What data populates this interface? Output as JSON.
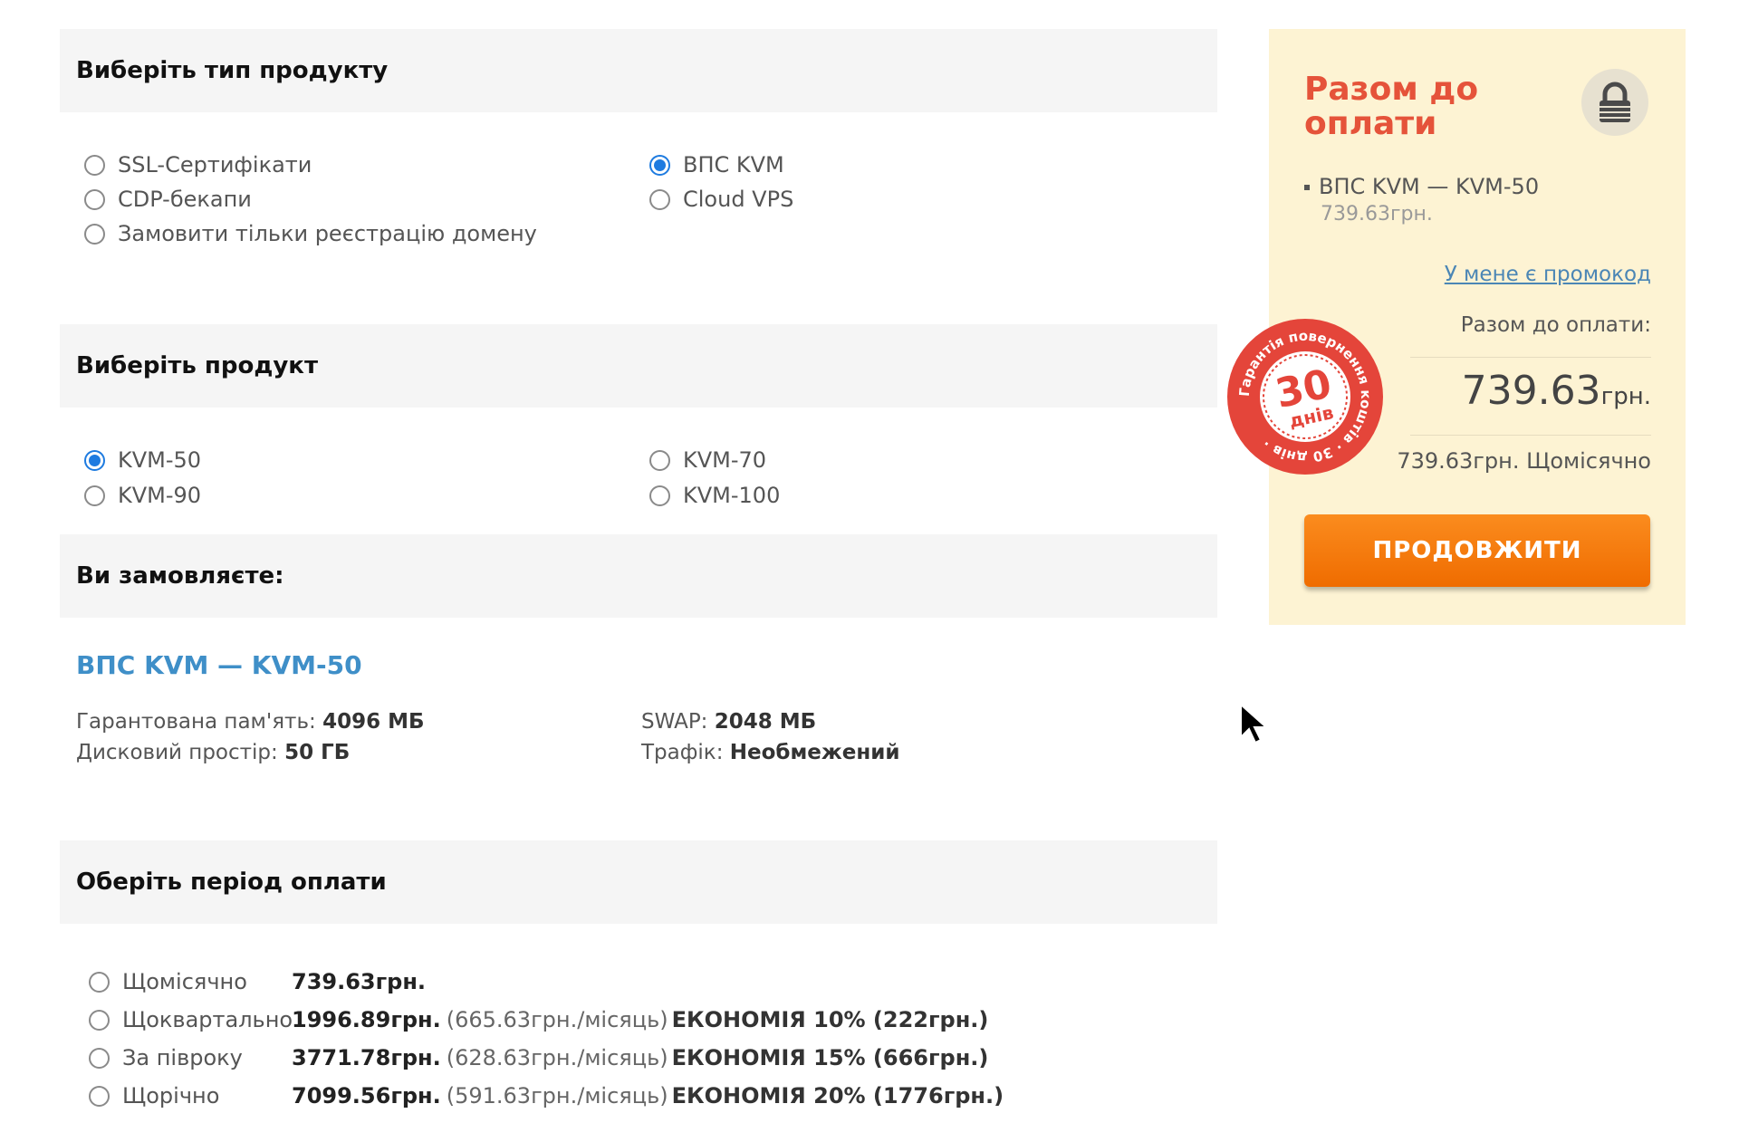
{
  "product_type": {
    "heading": "Виберіть тип продукту",
    "options": [
      {
        "label": "SSL-Сертифікати",
        "checked": false
      },
      {
        "label": "CDP-бекапи",
        "checked": false
      },
      {
        "label": "Замовити тільки реєстрацію домену",
        "checked": false
      },
      {
        "label": "ВПС KVM",
        "checked": true
      },
      {
        "label": "Cloud VPS",
        "checked": false
      }
    ]
  },
  "product": {
    "heading": "Виберіть продукт",
    "options": [
      {
        "label": "KVM-50",
        "checked": true
      },
      {
        "label": "KVM-90",
        "checked": false
      },
      {
        "label": "KVM-70",
        "checked": false
      },
      {
        "label": "KVM-100",
        "checked": false
      }
    ]
  },
  "order": {
    "heading": "Ви замовляєте:",
    "title": "ВПС KVM — KVM-50",
    "specs": [
      {
        "label": "Гарантована пам'ять:",
        "value": "4096 МБ"
      },
      {
        "label": "Дисковий простір:",
        "value": "50 ГБ"
      },
      {
        "label": "SWAP:",
        "value": "2048 МБ"
      },
      {
        "label": "Трафік:",
        "value": "Необмежений"
      }
    ]
  },
  "period": {
    "heading": "Оберіть період оплати",
    "options": [
      {
        "label": "Щомісячно",
        "price": "739.63грн.",
        "monthly": "",
        "saving": "",
        "checked": false
      },
      {
        "label": "Щоквартально",
        "price": "1996.89грн.",
        "monthly": "(665.63грн./місяць)",
        "saving": "ЕКОНОМІЯ 10% (222грн.)",
        "checked": false
      },
      {
        "label": "За півроку",
        "price": "3771.78грн.",
        "monthly": "(628.63грн./місяць)",
        "saving": "ЕКОНОМІЯ 15% (666грн.)",
        "checked": false
      },
      {
        "label": "Щорічно",
        "price": "7099.56грн.",
        "monthly": "(591.63грн./місяць)",
        "saving": "ЕКОНОМІЯ 20% (1776грн.)",
        "checked": false
      }
    ]
  },
  "summary": {
    "title": "Разом до оплати",
    "item_name": "ВПС KVM — KVM-50",
    "item_price": "739.63грн.",
    "promo_link": "У мене є промокод",
    "total_label": "Разом до оплати:",
    "total_amount": "739.63",
    "total_currency": "грн.",
    "total_period": "739.63грн. Щомісячно",
    "continue_label": "ПРОДОВЖИТИ"
  },
  "badge": {
    "days": "30",
    "days_word": "днів",
    "ring_text": "Гарантія повернення коштів · 30 днів · "
  },
  "colors": {
    "accent_red": "#e5533a",
    "link_blue": "#3f8fc8",
    "button_orange": "#f57c00",
    "panel_bg": "#fdf3d3"
  },
  "icons": [
    "lock-icon",
    "cursor-icon"
  ]
}
